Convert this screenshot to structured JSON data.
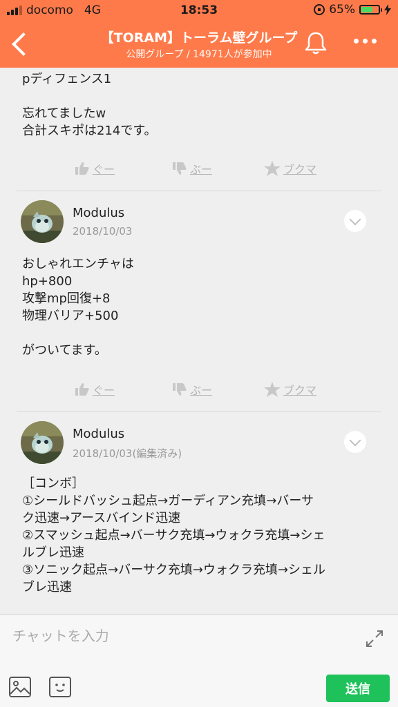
{
  "status_bar": {
    "carrier": "docomo",
    "network": "4G",
    "time": "18:53",
    "battery_percent": "65%",
    "battery_level": 0.65
  },
  "header": {
    "title": "【TORAM】トーラム壁グループ",
    "subtitle": "公開グループ / 14971人が参加中"
  },
  "posts": [
    {
      "text": "pディフェンス1\n\n忘れてましたw\n合計スキポは214です。",
      "reactions": {
        "good": "ぐー",
        "boo": "ぶー",
        "bookmark": "ブクマ"
      }
    },
    {
      "author": "Modulus",
      "date": "2018/10/03",
      "text": "おしゃれエンチャは\nhp+800\n攻撃mp回復+8\n物理バリア+500\n\nがついてます。",
      "reactions": {
        "good": "ぐー",
        "boo": "ぶー",
        "bookmark": "ブクマ"
      }
    },
    {
      "author": "Modulus",
      "date": "2018/10/03(編集済み)",
      "text": "［コンボ］\n①シールドバッシュ起点→ガーディアン充填→バーサ\nク迅速→アースバインド迅速\n②スマッシュ起点→バーサク充填→ウォクラ充填→シェ\nルブレ迅速\n③ソニック起点→バーサク充填→ウォクラ充填→シェル\nブレ迅速"
    }
  ],
  "composer": {
    "placeholder": "チャットを入力",
    "send_label": "送信"
  },
  "colors": {
    "header_bg": "#fe7a4a",
    "send_bg": "#1fc25a"
  }
}
